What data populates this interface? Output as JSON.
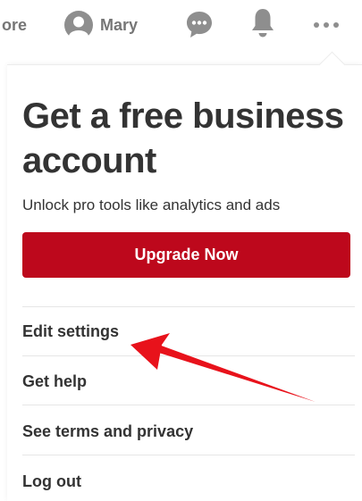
{
  "topnav": {
    "more_label": "ore",
    "username": "Mary",
    "icons": [
      "avatar-icon",
      "messages-icon",
      "notifications-icon",
      "more-icon"
    ]
  },
  "dropdown": {
    "promo": {
      "title": "Get a free business account",
      "subtitle": "Unlock pro tools like analytics and ads",
      "button_label": "Upgrade Now"
    },
    "menu_items": [
      "Edit settings",
      "Get help",
      "See terms and privacy",
      "Log out"
    ]
  },
  "annotation": {
    "target": "Edit settings",
    "icon": "red-arrow-annotation"
  },
  "colors": {
    "brand_red": "#bd081c",
    "nav_gray": "#767676",
    "text_dark": "#333333",
    "annotation_red": "#e8121b"
  }
}
